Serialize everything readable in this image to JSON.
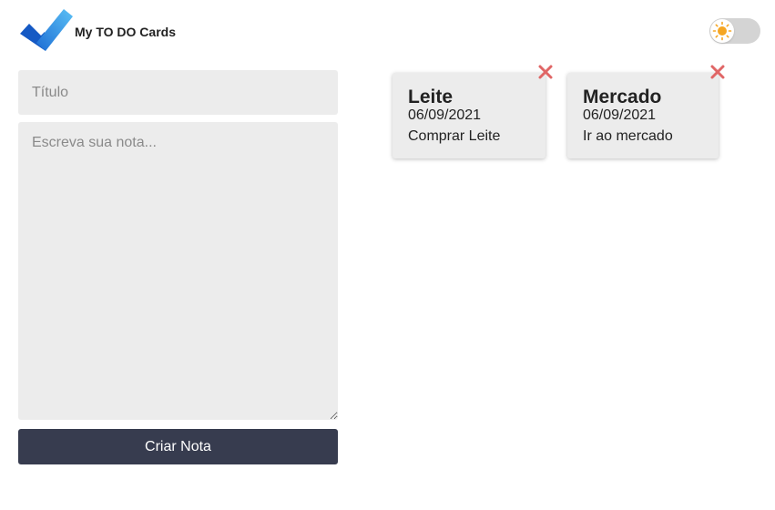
{
  "app": {
    "title": "My TO DO Cards"
  },
  "theme_toggle": {
    "mode": "light",
    "icon": "sun-icon"
  },
  "form": {
    "title_placeholder": "Título",
    "title_value": "",
    "note_placeholder": "Escreva sua nota...",
    "note_value": "",
    "submit_label": "Criar Nota"
  },
  "notes": [
    {
      "title": "Leite",
      "date": "06/09/2021",
      "body": "Comprar Leite"
    },
    {
      "title": "Mercado",
      "date": "06/09/2021",
      "body": "Ir ao mercado"
    }
  ],
  "colors": {
    "accent": "#373c4f",
    "close": "#e06666",
    "logo_dark": "#1a5fc6",
    "logo_light": "#4cb0f0",
    "sun": "#f5a623"
  }
}
